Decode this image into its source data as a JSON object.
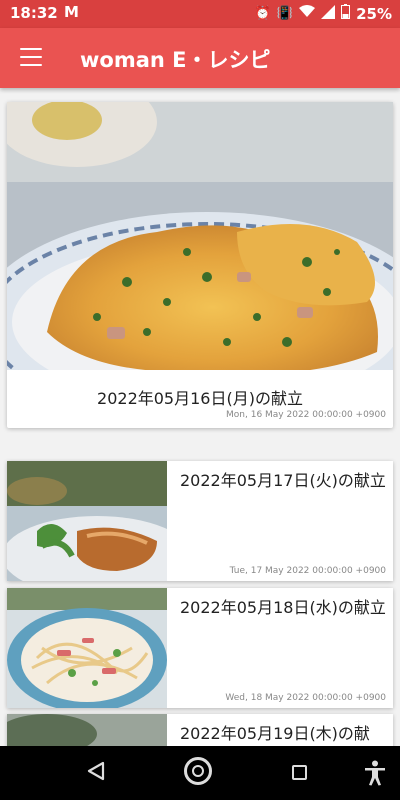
{
  "status_bar": {
    "time": "18:32",
    "mail_icon": "gmail-icon",
    "battery": "25%",
    "icons": [
      "alarm-icon",
      "vibrate-icon",
      "wifi-icon",
      "signal-icon",
      "battery-icon"
    ]
  },
  "app_bar": {
    "title": "woman E・レシピ",
    "menu_icon": "hamburger-menu-icon"
  },
  "colors": {
    "status_bar": "#d9403f",
    "app_bar": "#ea5351",
    "background": "#f2f2f2"
  },
  "featured": {
    "title": "2022年05月16日(月)の献立",
    "date": "Mon, 16 May 2022 00:00:00 +0900"
  },
  "items": [
    {
      "title": "2022年05月17日(火)の献立",
      "date": "Tue, 17 May 2022 00:00:00 +0900"
    },
    {
      "title": "2022年05月18日(水)の献立",
      "date": "Wed, 18 May 2022 00:00:00 +0900"
    },
    {
      "title": "2022年05月19日(木)の献",
      "date": ""
    }
  ],
  "nav_bar": {
    "buttons": [
      "back-icon",
      "home-icon",
      "recent-apps-icon",
      "accessibility-icon"
    ]
  }
}
